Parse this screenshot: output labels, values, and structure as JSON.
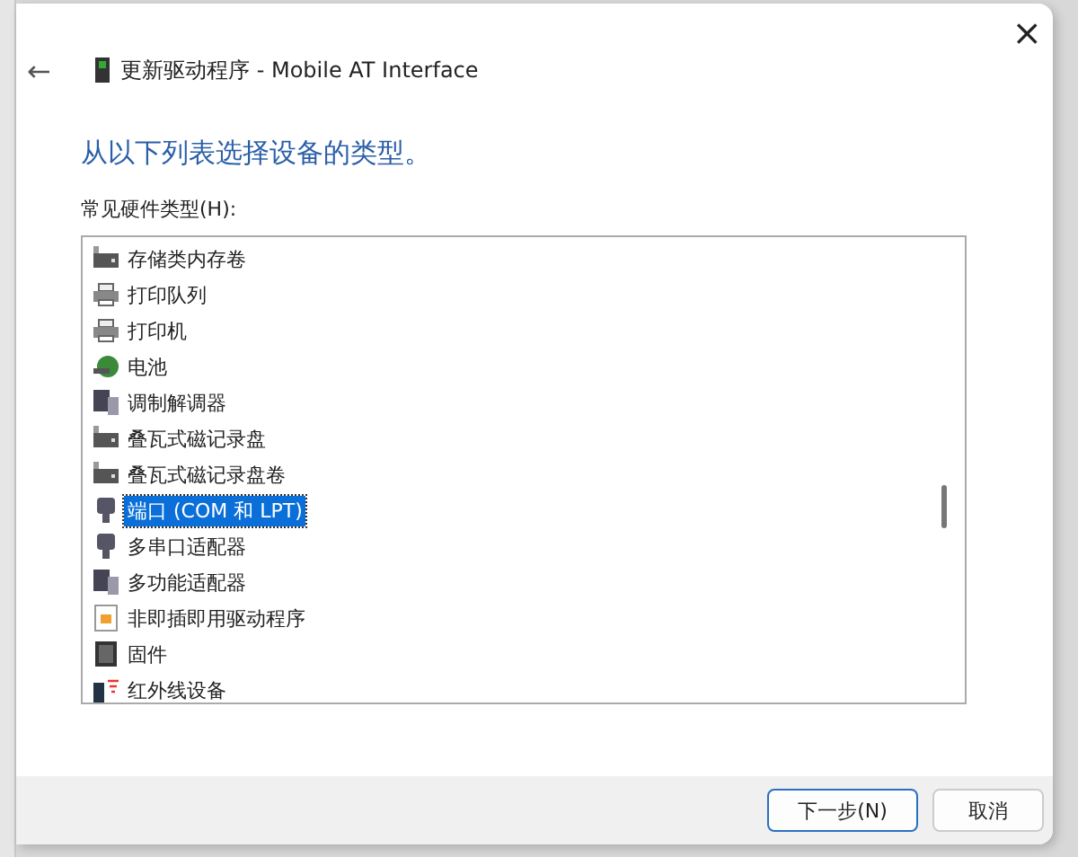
{
  "window": {
    "title": "更新驱动程序 - Mobile AT Interface",
    "close": "×",
    "back": "←"
  },
  "heading": "从以下列表选择设备的类型。",
  "list_label": "常见硬件类型(H):",
  "items": [
    {
      "label": "存储类内存卷",
      "kind": "drive",
      "selected": false
    },
    {
      "label": "打印队列",
      "kind": "printer",
      "selected": false
    },
    {
      "label": "打印机",
      "kind": "printer",
      "selected": false
    },
    {
      "label": "电池",
      "kind": "battery",
      "selected": false
    },
    {
      "label": "调制解调器",
      "kind": "modem",
      "selected": false
    },
    {
      "label": "叠瓦式磁记录盘",
      "kind": "drive",
      "selected": false
    },
    {
      "label": "叠瓦式磁记录盘卷",
      "kind": "drive",
      "selected": false
    },
    {
      "label": "端口 (COM 和 LPT)",
      "kind": "port",
      "selected": true
    },
    {
      "label": "多串口适配器",
      "kind": "port",
      "selected": false
    },
    {
      "label": "多功能适配器",
      "kind": "modem",
      "selected": false
    },
    {
      "label": "非即插即用驱动程序",
      "kind": "file",
      "selected": false
    },
    {
      "label": "固件",
      "kind": "chip",
      "selected": false
    },
    {
      "label": "红外线设备",
      "kind": "infrared",
      "selected": false
    }
  ],
  "buttons": [
    {
      "label": "下一步(N)",
      "default": true
    },
    {
      "label": "取消",
      "default": false
    }
  ]
}
